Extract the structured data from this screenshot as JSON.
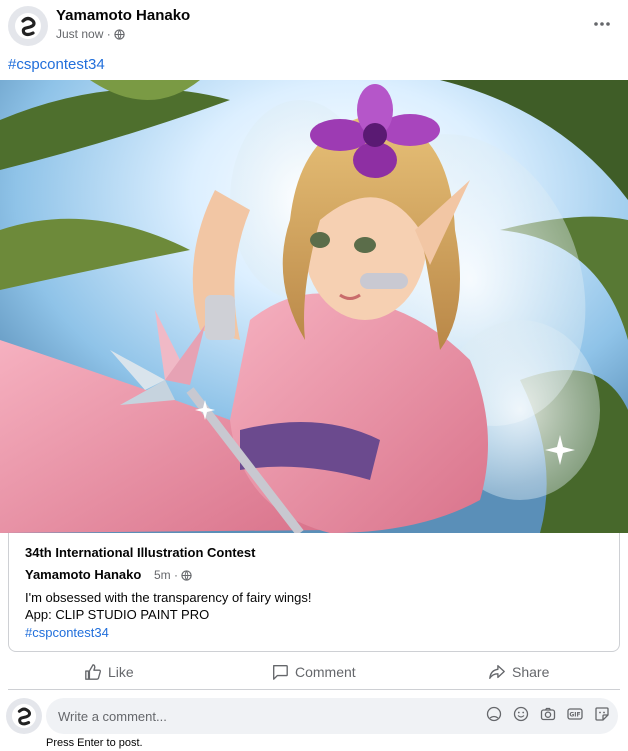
{
  "post": {
    "author": "Yamamoto Hanako",
    "timestamp": "Just now ·",
    "privacy_icon": "globe-icon",
    "hashtag": "#cspcontest34"
  },
  "caption": {
    "title": "34th International Illustration Contest",
    "author": "Yamamoto Hanako",
    "time": "5m ·",
    "line1": "I'm obsessed with the transparency of fairy wings!",
    "line2": "App: CLIP STUDIO PAINT PRO",
    "tag": "#cspcontest34"
  },
  "actions": {
    "like": "Like",
    "comment": "Comment",
    "share": "Share"
  },
  "comment_box": {
    "placeholder": "Write a comment...",
    "hint": "Press Enter to post."
  },
  "colors": {
    "link": "#216fdb",
    "muted": "#65676b",
    "divider": "#ced0d4"
  }
}
